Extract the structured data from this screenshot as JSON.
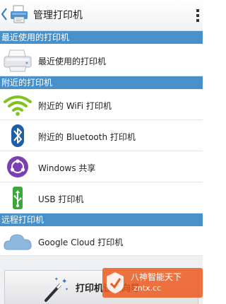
{
  "colors": {
    "section_header_bg": "#4a90c8",
    "section_header_text": "#ffffff",
    "wifi_icon": "#7fc41c",
    "bluetooth_icon": "#1e5fa8",
    "windows_share_icon": "#7a3fb0",
    "usb_icon": "#3aa83a",
    "cloud_icon": "#8cb8e0",
    "watermark_bg": "#eb5a1e"
  },
  "header": {
    "back_icon": "chevron-left-icon",
    "app_icon": "printer-app-icon",
    "title": "管理打印机",
    "overflow_icon": "overflow-menu-icon"
  },
  "sections": {
    "recent": {
      "label": "最近使用的打印机",
      "items": [
        {
          "icon": "printer-icon",
          "label": "最近使用的打印机"
        }
      ]
    },
    "nearby": {
      "label": "附近的打印机",
      "items": [
        {
          "icon": "wifi-icon",
          "label": "附近的 WiFi 打印机"
        },
        {
          "icon": "bluetooth-icon",
          "label": "附近的 Bluetooth 打印机"
        },
        {
          "icon": "windows-share-icon",
          "label": "Windows 共享"
        },
        {
          "icon": "usb-icon",
          "label": "USB 打印机"
        }
      ]
    },
    "remote": {
      "label": "远程打印机",
      "items": [
        {
          "icon": "cloud-icon",
          "label": "Google Cloud 打印机"
        }
      ]
    }
  },
  "wizard": {
    "icon": "magic-wand-icon",
    "label": "打印机设置向导"
  },
  "watermark": {
    "line1": "八神智能天下",
    "line2": "zntx.cc"
  }
}
